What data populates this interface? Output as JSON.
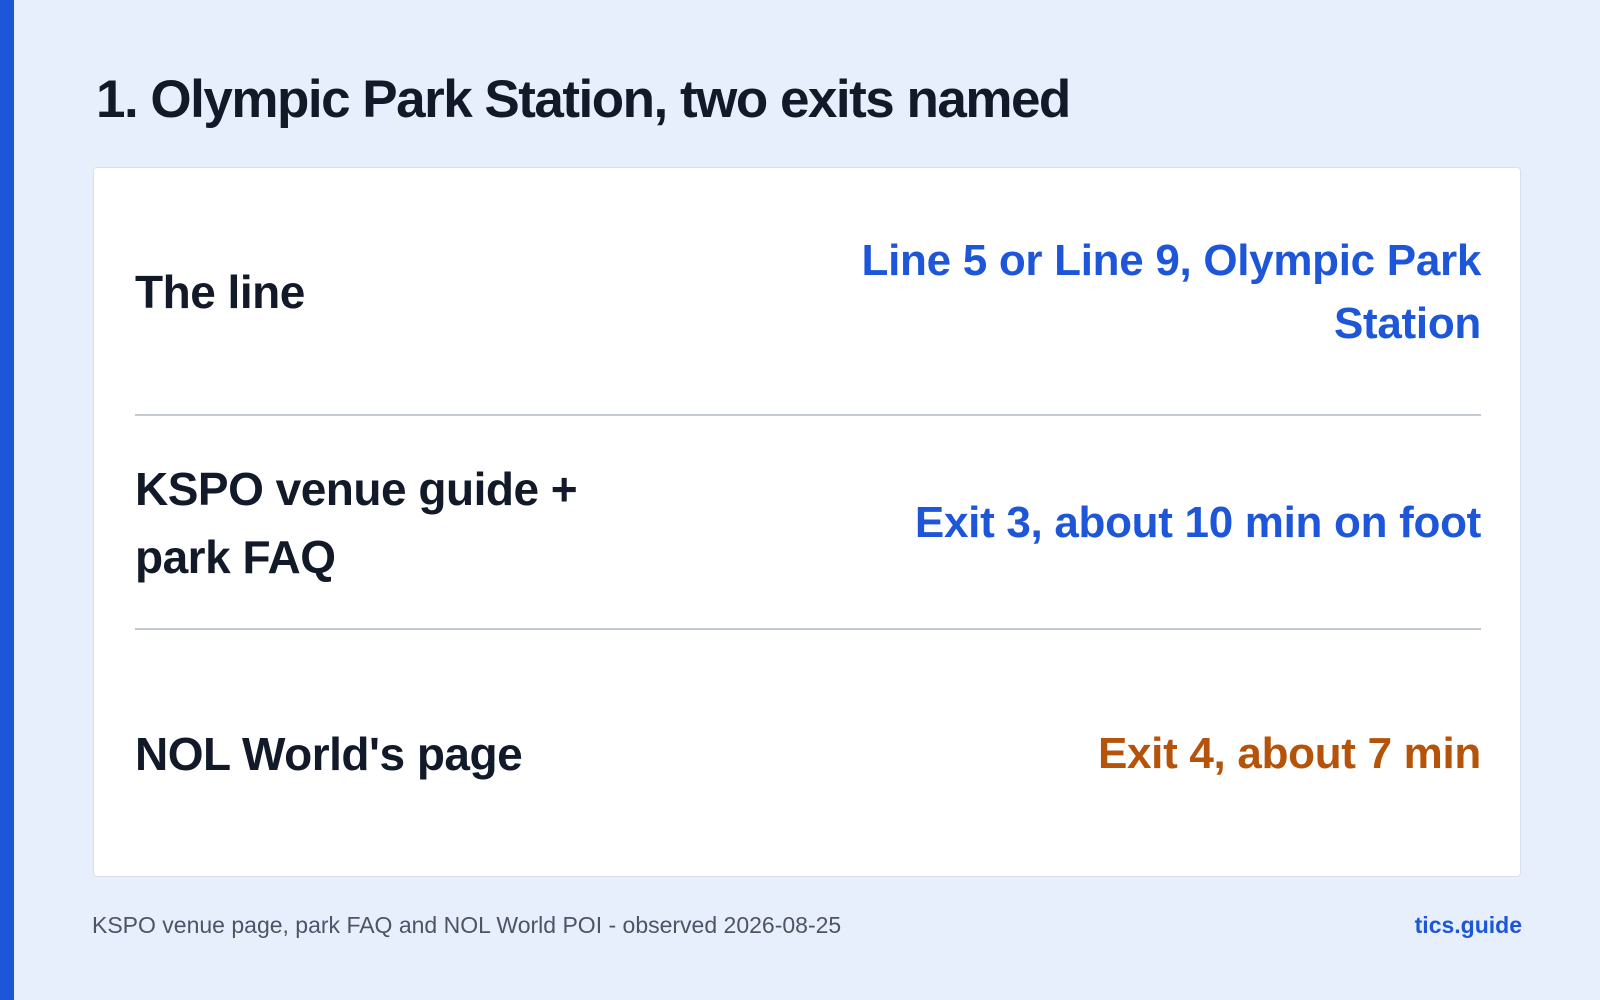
{
  "title": "1. Olympic Park Station, two exits named",
  "rows": [
    {
      "label": "The line",
      "value": "Line 5 or Line 9, Olympic Park Station"
    },
    {
      "label": "KSPO venue guide + park FAQ",
      "value": "Exit 3, about 10 min on foot"
    },
    {
      "label": "NOL World's page",
      "value": "Exit 4, about 7 min"
    }
  ],
  "footer": {
    "source": "KSPO venue page, park FAQ and NOL World POI - observed 2026-08-25",
    "brand": "tics.guide"
  },
  "colors": {
    "accent": "#1d56d8",
    "highlight": "#b45309",
    "background": "#e8effc",
    "text": "#121a2a"
  }
}
